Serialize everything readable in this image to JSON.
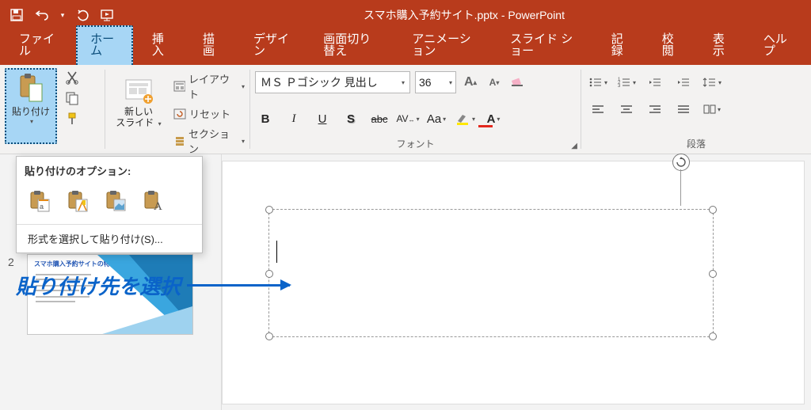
{
  "titlebar": {
    "title_document": "スマホ購入予約サイト.pptx",
    "title_separator": " - ",
    "title_app": "PowerPoint"
  },
  "tabs": {
    "file": "ファイル",
    "home": "ホーム",
    "insert": "挿入",
    "draw": "描画",
    "design": "デザイン",
    "transitions": "画面切り替え",
    "animations": "アニメーション",
    "slideshow": "スライド ショー",
    "record": "記録",
    "review": "校閲",
    "view": "表示",
    "help": "ヘルプ"
  },
  "clipboard": {
    "paste_label": "貼り付け"
  },
  "slides": {
    "new_slide_line1": "新しい",
    "new_slide_line2": "スライド",
    "layout": "レイアウト",
    "reset": "リセット",
    "section": "セクション"
  },
  "font": {
    "name": "ＭＳ Ｐゴシック 見出し",
    "size": "36",
    "group_label": "フォント",
    "increase": "A",
    "decrease": "A",
    "bold": "B",
    "italic": "I",
    "underline": "U",
    "shadow": "S",
    "strike": "abc",
    "spacing": "AV",
    "change_case": "Aa"
  },
  "paragraph": {
    "group_label": "段落"
  },
  "paste_popup": {
    "header": "貼り付けのオプション:",
    "special": "形式を選択して貼り付け(S)..."
  },
  "annotation": {
    "text": "貼り付け先を選択"
  },
  "thumbnails": {
    "slide2_num": "2",
    "slide2_title": "スマホ購入予約サイトの特徴"
  }
}
